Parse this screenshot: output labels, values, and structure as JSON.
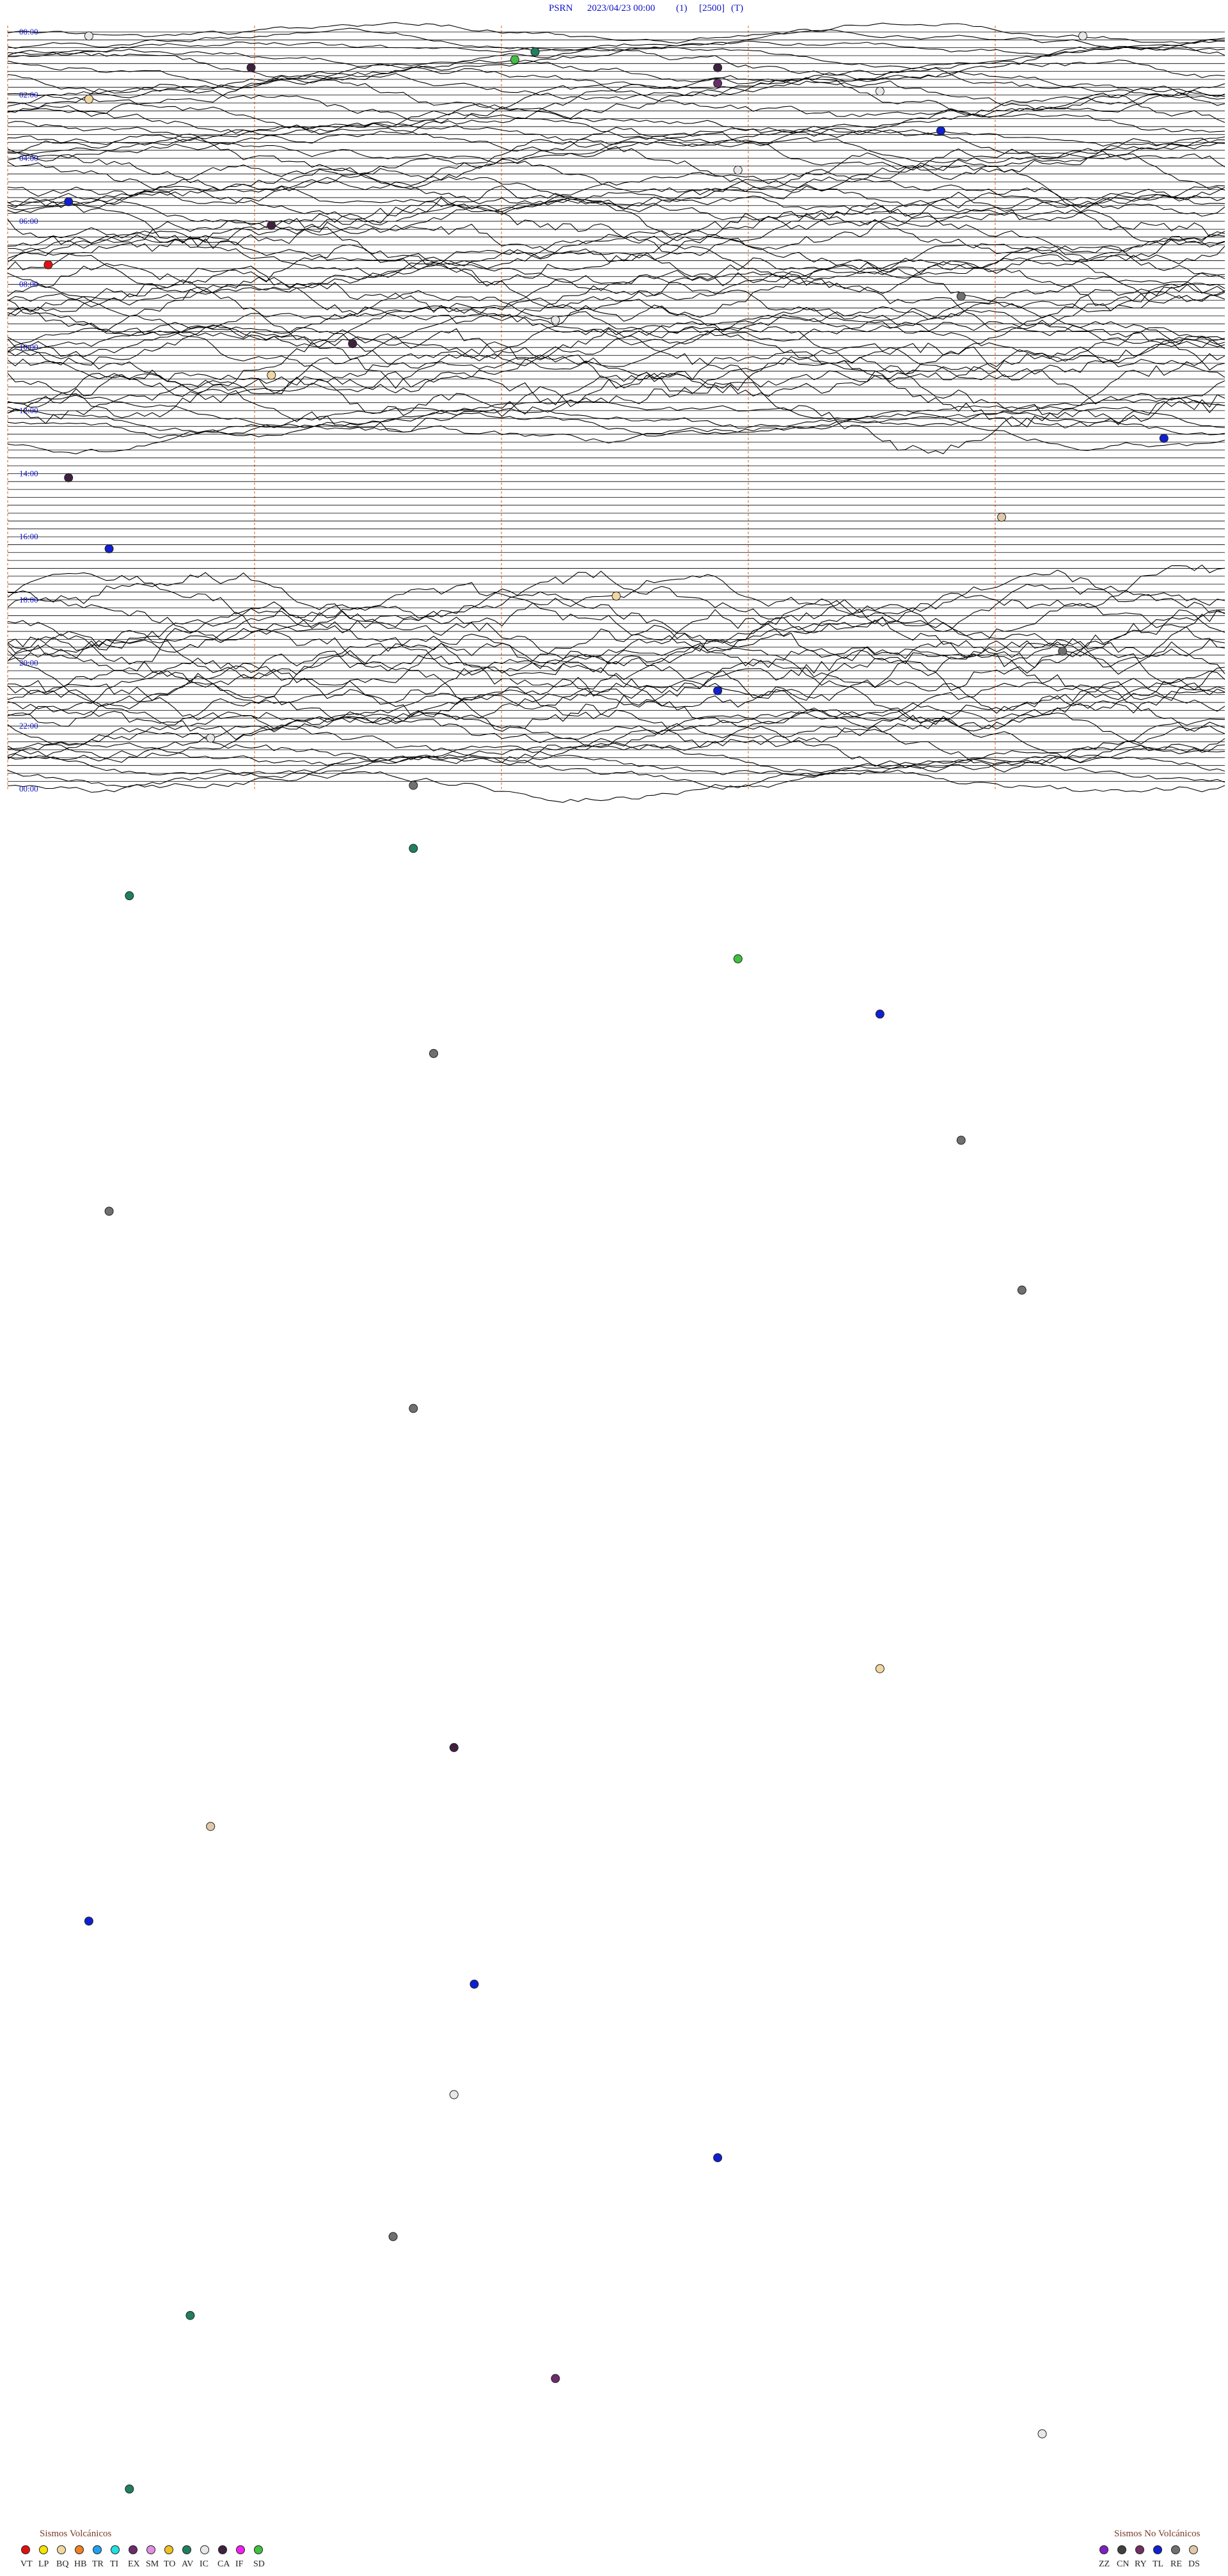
{
  "header": {
    "station": "PSRN",
    "datetime": "2023/04/23 00:00",
    "channel": "(1)",
    "gain": "[2500]",
    "mode": "(T)"
  },
  "chart_data": {
    "type": "helicorder",
    "station": "PSRN",
    "date": "2023/04/23",
    "lines_per_hour": 4,
    "hours_shown": 24,
    "time_labels": [
      "00:00",
      "02:00",
      "04:00",
      "06:00",
      "08:00",
      "10:00",
      "12:00",
      "14:00",
      "16:00",
      "18:00",
      "20:00",
      "22:00",
      "00:00"
    ],
    "minute_markers": 4,
    "noise_profile_by_hour": [
      2,
      3,
      4,
      3,
      5,
      4,
      6,
      5,
      6,
      5,
      6,
      7,
      3,
      1,
      1,
      1,
      1,
      1,
      6,
      7,
      7,
      6,
      5,
      3
    ],
    "events": [
      {
        "line": 1,
        "minute": 4,
        "code": "IC"
      },
      {
        "line": 1,
        "minute": 53,
        "code": "IC"
      },
      {
        "line": 3,
        "minute": 26,
        "code": "AV"
      },
      {
        "line": 4,
        "minute": 25,
        "code": "SD"
      },
      {
        "line": 5,
        "minute": 12,
        "code": "CA"
      },
      {
        "line": 5,
        "minute": 35,
        "code": "CA"
      },
      {
        "line": 7,
        "minute": 35,
        "code": "EX"
      },
      {
        "line": 8,
        "minute": 43,
        "code": "IC"
      },
      {
        "line": 9,
        "minute": 4,
        "code": "BQ"
      },
      {
        "line": 13,
        "minute": 46,
        "code": "TL"
      },
      {
        "line": 18,
        "minute": 36,
        "code": "IC"
      },
      {
        "line": 22,
        "minute": 3,
        "code": "TL"
      },
      {
        "line": 25,
        "minute": 13,
        "code": "CA"
      },
      {
        "line": 30,
        "minute": 2,
        "code": "VT"
      },
      {
        "line": 34,
        "minute": 47,
        "code": "RE"
      },
      {
        "line": 37,
        "minute": 27,
        "code": "IC"
      },
      {
        "line": 40,
        "minute": 17,
        "code": "CA"
      },
      {
        "line": 44,
        "minute": 13,
        "code": "BQ"
      },
      {
        "line": 52,
        "minute": 57,
        "code": "TL"
      },
      {
        "line": 57,
        "minute": 3,
        "code": "CA"
      },
      {
        "line": 62,
        "minute": 49,
        "code": "DS"
      },
      {
        "line": 66,
        "minute": 5,
        "code": "TL"
      },
      {
        "line": 72,
        "minute": 30,
        "code": "BQ"
      },
      {
        "line": 79,
        "minute": 52,
        "code": "RE"
      },
      {
        "line": 84,
        "minute": 35,
        "code": "TL"
      },
      {
        "line": 90,
        "minute": 10,
        "code": "IC"
      },
      {
        "line": 96,
        "minute": 20,
        "code": "RE"
      },
      {
        "line": 104,
        "minute": 20,
        "code": "AV"
      },
      {
        "line": 110,
        "minute": 6,
        "code": "AV"
      },
      {
        "line": 118,
        "minute": 36,
        "code": "SD"
      },
      {
        "line": 125,
        "minute": 43,
        "code": "TL"
      },
      {
        "line": 130,
        "minute": 21,
        "code": "RE"
      },
      {
        "line": 141,
        "minute": 47,
        "code": "RE"
      },
      {
        "line": 150,
        "minute": 5,
        "code": "RE"
      },
      {
        "line": 160,
        "minute": 50,
        "code": "RE"
      },
      {
        "line": 175,
        "minute": 20,
        "code": "RE"
      },
      {
        "line": 208,
        "minute": 43,
        "code": "BQ"
      },
      {
        "line": 218,
        "minute": 22,
        "code": "CA"
      },
      {
        "line": 228,
        "minute": 10,
        "code": "DS"
      },
      {
        "line": 240,
        "minute": 4,
        "code": "TL"
      },
      {
        "line": 248,
        "minute": 23,
        "code": "TL"
      },
      {
        "line": 262,
        "minute": 22,
        "code": "IC"
      },
      {
        "line": 270,
        "minute": 35,
        "code": "TL"
      },
      {
        "line": 280,
        "minute": 19,
        "code": "RE"
      },
      {
        "line": 290,
        "minute": 9,
        "code": "AV"
      },
      {
        "line": 298,
        "minute": 27,
        "code": "EX"
      },
      {
        "line": 305,
        "minute": 51,
        "code": "IC"
      },
      {
        "line": 312,
        "minute": 6,
        "code": "AV"
      }
    ]
  },
  "legend": {
    "volcanic_title": "Sismos Volcánicos",
    "nonvolcanic_title": "Sismos No Volcánicos",
    "volcanic": [
      {
        "code": "VT",
        "color": "#e01010"
      },
      {
        "code": "LP",
        "color": "#f4e400"
      },
      {
        "code": "BQ",
        "color": "#f0d8a0"
      },
      {
        "code": "HB",
        "color": "#f08020"
      },
      {
        "code": "TR",
        "color": "#20a0f0"
      },
      {
        "code": "TI",
        "color": "#20e0e0"
      },
      {
        "code": "EX",
        "color": "#6a2c6a"
      },
      {
        "code": "SM",
        "color": "#e090e0"
      },
      {
        "code": "TO",
        "color": "#f0c020"
      },
      {
        "code": "AV",
        "color": "#1f7f5f"
      },
      {
        "code": "IC",
        "color": "#e8e8e8"
      },
      {
        "code": "CA",
        "color": "#402040"
      },
      {
        "code": "IF",
        "color": "#f020f0"
      },
      {
        "code": "SD",
        "color": "#40c040"
      }
    ],
    "nonvolcanic": [
      {
        "code": "ZZ",
        "color": "#8020c0"
      },
      {
        "code": "CN",
        "color": "#404040"
      },
      {
        "code": "RY",
        "color": "#703060"
      },
      {
        "code": "TL",
        "color": "#1020d0"
      },
      {
        "code": "RE",
        "color": "#707070"
      },
      {
        "code": "DS",
        "color": "#e0c8a8"
      }
    ]
  },
  "colors": {
    "trace": "#000000",
    "label": "#1010c8",
    "marker_line": "#e06020"
  }
}
